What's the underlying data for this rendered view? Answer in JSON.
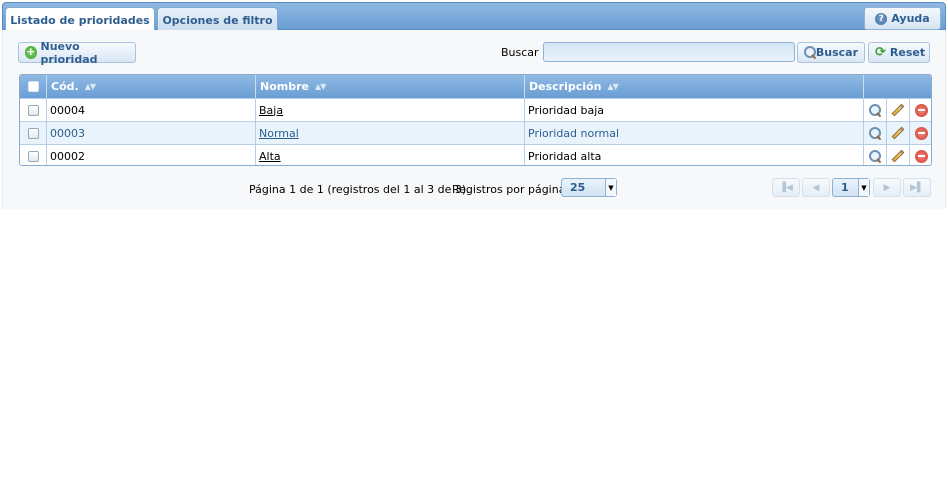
{
  "tabs": [
    {
      "label": "Listado de prioridades",
      "active": true
    },
    {
      "label": "Opciones de filtro",
      "active": false
    }
  ],
  "help": {
    "label": "Ayuda",
    "icon": "help-icon"
  },
  "toolbar": {
    "new_label": "Nuevo prioridad",
    "search_label": "Buscar",
    "search_value": "",
    "search_button": "Buscar",
    "reset_button": "Reset"
  },
  "grid": {
    "columns": [
      "Cód.",
      "Nombre",
      "Descripción"
    ],
    "rows": [
      {
        "code": "00004",
        "name": "Baja",
        "description": "Prioridad baja"
      },
      {
        "code": "00003",
        "name": "Normal",
        "description": "Prioridad normal"
      },
      {
        "code": "00002",
        "name": "Alta",
        "description": "Prioridad alta"
      }
    ]
  },
  "pager": {
    "summary": "Página 1 de 1 (registros del 1 al 3 de 3).",
    "per_page_label": "Registros por página:",
    "per_page_value": "25",
    "current_page": "1"
  },
  "colors": {
    "accent": "#6a9ed4",
    "text_link": "#2e5e8f",
    "row_alt": "#e9f3fc"
  }
}
